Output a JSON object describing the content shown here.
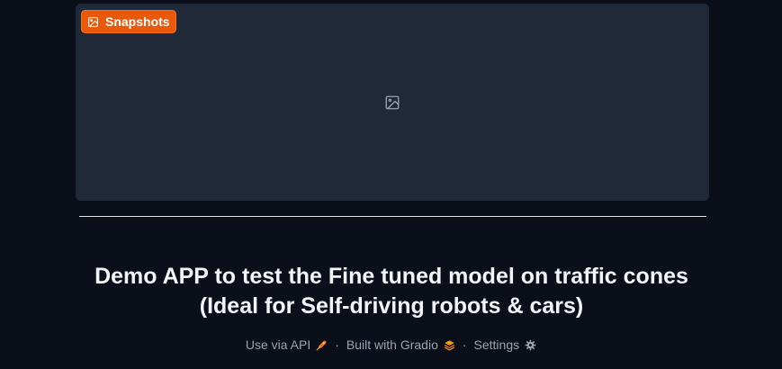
{
  "gallery": {
    "badge_label": "Snapshots",
    "badge_icon": "image-icon",
    "empty_icon": "image-placeholder-icon"
  },
  "title": {
    "line1": "Demo APP to test the Fine tuned model on traffic cones",
    "line2": "(Ideal for Self-driving robots & cars)"
  },
  "footer": {
    "api_label": "Use via API",
    "api_icon": "rocket-icon",
    "separator": "·",
    "built_label": "Built with Gradio",
    "built_icon": "gradio-logo-icon",
    "settings_label": "Settings",
    "settings_icon": "gear-icon"
  },
  "colors": {
    "background": "#0b0f19",
    "panel": "#1f2937",
    "accent": "#ea580c",
    "text": "#f3f4f6",
    "muted": "#9ca3af"
  }
}
